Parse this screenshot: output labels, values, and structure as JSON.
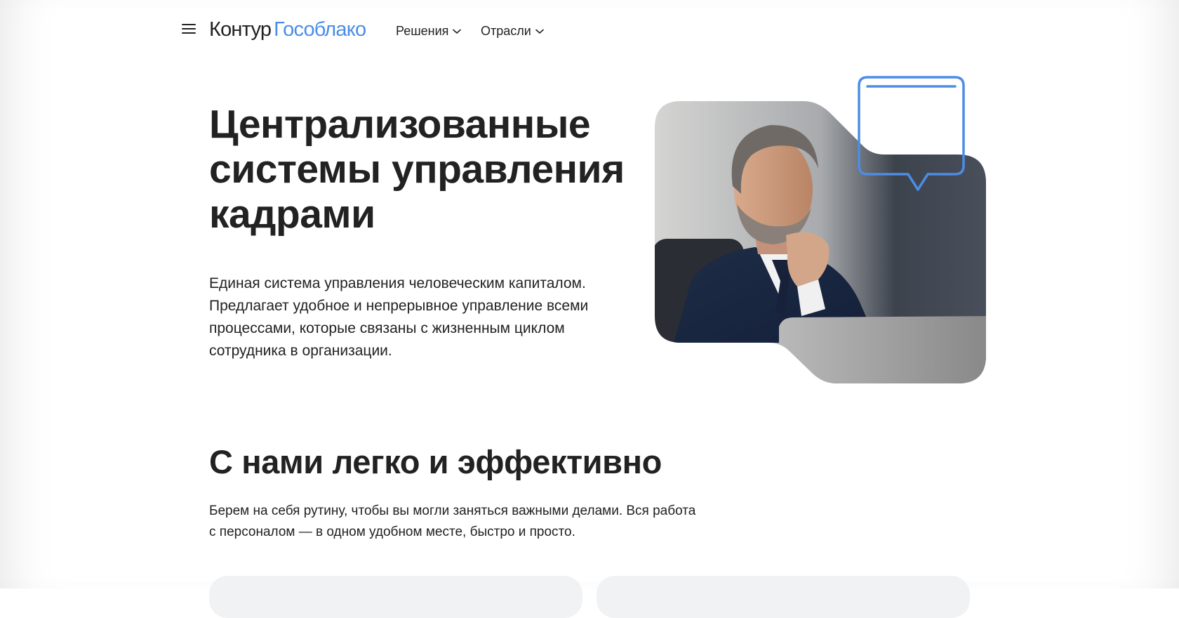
{
  "header": {
    "menu_icon": "hamburger-icon",
    "logo": {
      "primary": "Контур",
      "secondary": "Гособлако"
    },
    "nav": [
      {
        "label": "Решения",
        "icon": "chevron-down-icon"
      },
      {
        "label": "Отрасли",
        "icon": "chevron-down-icon"
      }
    ]
  },
  "hero": {
    "title_lines": [
      "Централизованные",
      "системы управления",
      "кадрами"
    ],
    "description_lines": [
      "Единая система управления человеческим капиталом.",
      "Предлагает удобное и непрерывное управление всеми",
      "процессами, которые связаны с жизненным циклом",
      "сотрудника в организации."
    ],
    "image_icon": "businessman-photo",
    "callout_icon": "speech-bubble-icon"
  },
  "section": {
    "title": "С нами легко и эффективно",
    "description_lines": [
      "Берем на себя рутину, чтобы вы могли заняться важными делами. Вся работа",
      "с персоналом — в одном удобном месте, быстро и просто."
    ]
  },
  "colors": {
    "accent": "#4b8de6",
    "text": "#222222",
    "background": "#ffffff"
  }
}
